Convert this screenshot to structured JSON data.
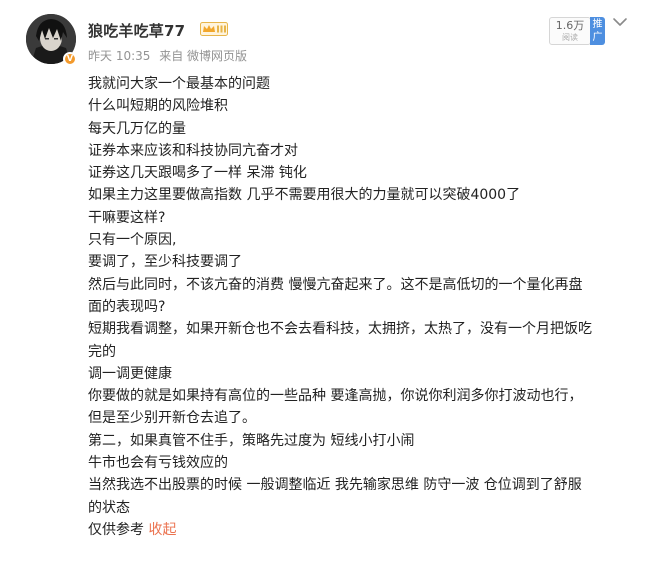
{
  "post": {
    "author": {
      "name": "狼吃羊吃草77",
      "avatar_icon": "avatar-illustration-icon",
      "verified_icon": "orange-verified-badge-icon",
      "level_icon": "crown-level-badge-icon"
    },
    "meta": {
      "time": "昨天 10:35",
      "source": "来自 微博网页版"
    },
    "stats": {
      "views": "1.6万",
      "views_label": "阅读",
      "promote_label": "推广"
    },
    "menu_icon": "chevron-down-icon",
    "lines": [
      "我就问大家一个最基本的问题",
      "什么叫短期的风险堆积",
      "每天几万亿的量",
      "证券本来应该和科技协同亢奋才对",
      "证券这几天跟喝多了一样  呆滞 钝化",
      "如果主力这里要做高指数  几乎不需要用很大的力量就可以突破4000了",
      "干嘛要这样?",
      "只有一个原因,",
      "要调了，至少科技要调了",
      "然后与此同时，不该亢奋的消费 慢慢亢奋起来了。这不是高低切的一个量化再盘",
      "面的表现吗?",
      "短期我看调整，如果开新仓也不会去看科技，太拥挤，太热了，没有一个月把饭吃",
      "完的",
      "调一调更健康",
      "你要做的就是如果持有高位的一些品种 要逢高抛，你说你利润多你打波动也行，",
      "但是至少别开新仓去追了。",
      "第二，如果真管不住手，策略先过度为 短线小打小闹",
      "牛市也会有亏钱效应的",
      "当然我选不出股票的时候  一般调整临近  我先输家思维 防守一波  仓位调到了舒服",
      "的状态",
      "仅供参考"
    ],
    "collapse_label": "收起"
  }
}
